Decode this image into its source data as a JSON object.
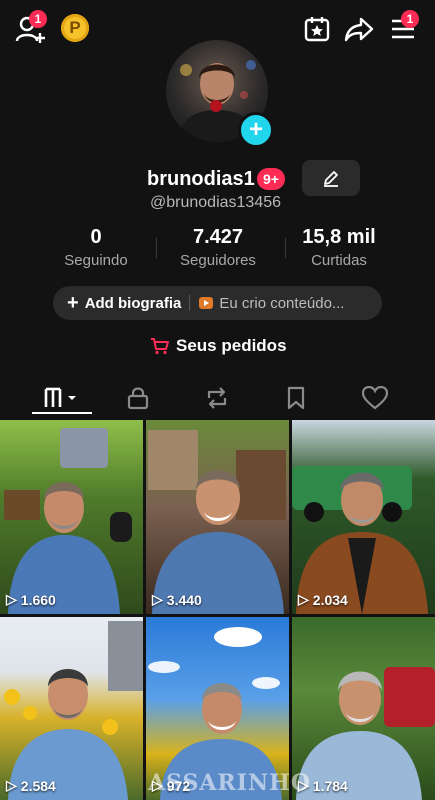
{
  "topbar": {
    "add_friends_badge": "1",
    "coin_letter": "P",
    "menu_badge": "1"
  },
  "profile": {
    "username": "brunodias1",
    "notif_badge": "9+",
    "handle": "@brunodias13456"
  },
  "stats": [
    {
      "value": "0",
      "label": "Seguindo"
    },
    {
      "value": "7.427",
      "label": "Seguidores"
    },
    {
      "value": "15,8 mil",
      "label": "Curtidas"
    }
  ],
  "bio": {
    "add_label": "Add biografia",
    "link_text": "Eu crio conteúdo..."
  },
  "orders": {
    "label": "Seus pedidos"
  },
  "videos": [
    {
      "views": "1.660"
    },
    {
      "views": "3.440"
    },
    {
      "views": "2.034"
    },
    {
      "views": "2.584"
    },
    {
      "views": "972"
    },
    {
      "views": "1.784"
    }
  ],
  "watermark": "ASSARINHO",
  "colors": {
    "accent_red": "#fe2c55",
    "accent_cyan": "#20d5ec",
    "background": "#121212"
  }
}
